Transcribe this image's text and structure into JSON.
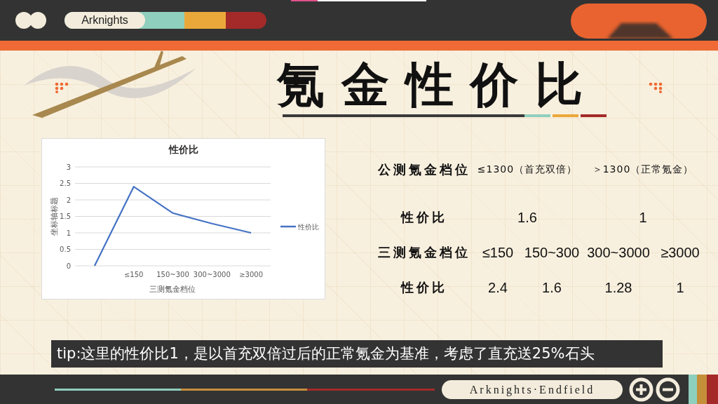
{
  "header": {
    "brand": "Arknights"
  },
  "title": "氪金性价比",
  "chart": {
    "chart_data": {
      "type": "line",
      "title": "性价比",
      "xlabel": "三测氪金档位",
      "ylabel": "坐标轴标题",
      "categories": [
        null,
        "≤150",
        "150~300",
        "300~3000",
        "≥3000"
      ],
      "ylim": [
        0,
        3
      ],
      "yticks": [
        0,
        0.5,
        1,
        1.5,
        2,
        2.5,
        3
      ],
      "grid": true,
      "series": [
        {
          "name": "性价比",
          "color": "#4472c4",
          "values": [
            0,
            2.4,
            1.6,
            1.28,
            1
          ]
        }
      ]
    }
  },
  "comparison_table": {
    "rows": [
      {
        "kind": "tier",
        "label": "公测氪金档位",
        "cells": [
          "≤1300（首充双倍）",
          "＞1300（正常氪金）"
        ]
      },
      {
        "kind": "ratio",
        "label": "性价比",
        "cells": [
          "1.6",
          "1"
        ]
      },
      {
        "kind": "tier",
        "label": "三测氪金档位",
        "cells": [
          "≤150",
          "150~300",
          "300~3000",
          "≥3000"
        ]
      },
      {
        "kind": "ratio",
        "label": "性价比",
        "cells": [
          "2.4",
          "1.6",
          "1.28",
          "1"
        ]
      }
    ]
  },
  "tip": "tip:这里的性价比1，是以首充双倍过后的正常氪金为基准，考虑了直充送25%石头",
  "footer": {
    "brand": "Arknights·Endfield"
  }
}
